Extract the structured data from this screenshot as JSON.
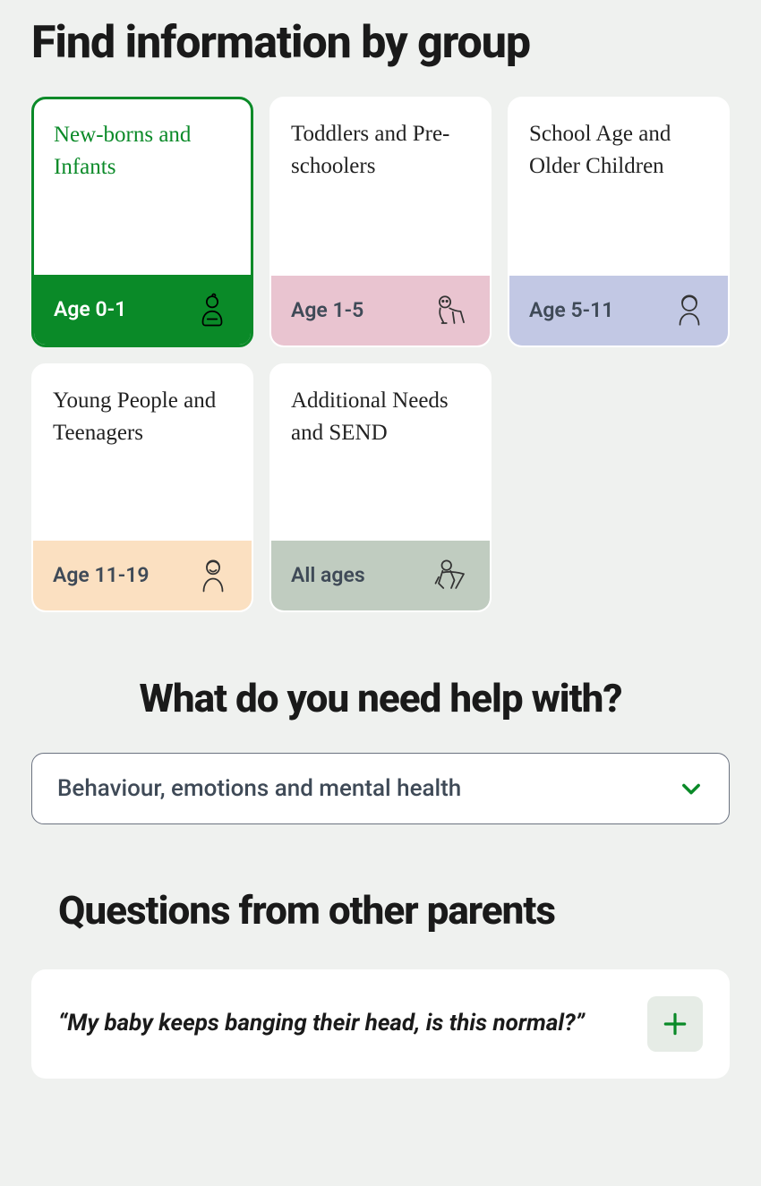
{
  "heading": "Find information by group",
  "groups": [
    {
      "title": "New-borns and Infants",
      "age": "Age 0-1",
      "icon": "baby-icon",
      "bottom_bg": "bg-green",
      "active": true
    },
    {
      "title": "Toddlers and Pre-schoolers",
      "age": "Age 1-5",
      "icon": "toddler-icon",
      "bottom_bg": "bg-pink",
      "active": false
    },
    {
      "title": "School Age and Older Children",
      "age": "Age 5-11",
      "icon": "child-icon",
      "bottom_bg": "bg-purple",
      "active": false
    },
    {
      "title": "Young People and Teenagers",
      "age": "Age 11-19",
      "icon": "teen-icon",
      "bottom_bg": "bg-peach",
      "active": false
    },
    {
      "title": "Additional Needs and SEND",
      "age": "All ages",
      "icon": "superhero-icon",
      "bottom_bg": "bg-sage",
      "active": false
    }
  ],
  "help_heading": "What do you need help with?",
  "dropdown": {
    "selected": "Behaviour, emotions and mental health"
  },
  "questions_heading": "Questions from other parents",
  "questions": [
    {
      "text": "“My baby keeps banging their head, is this normal?”"
    }
  ],
  "colors": {
    "accent_green": "#0a8a28"
  }
}
